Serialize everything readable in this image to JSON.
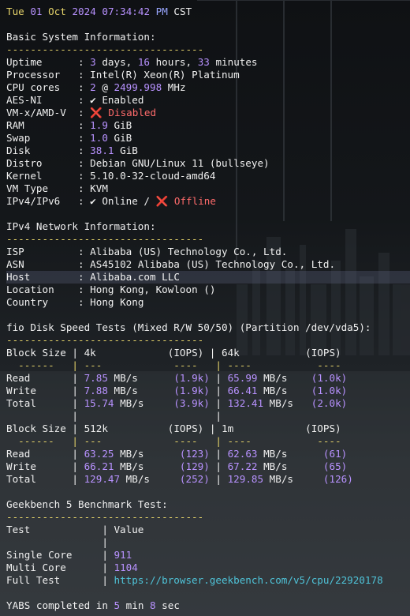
{
  "timestamp": {
    "day": "Tue",
    "date": "01",
    "month": "Oct",
    "year": "2024",
    "time": "07:34:42",
    "ampm": "PM",
    "tz": "CST"
  },
  "basic": {
    "title": "Basic System Information:",
    "dashes": "---------------------------------",
    "uptime": {
      "label": "Uptime",
      "days": "3",
      "hours": "16",
      "minutes": "33"
    },
    "processor": {
      "label": "Processor",
      "value": "Intel(R) Xeon(R) Platinum"
    },
    "cpu": {
      "label": "CPU cores",
      "count": "2",
      "freq": "2499.998",
      "unit": "MHz"
    },
    "aes": {
      "label": "AES-NI",
      "value": "✔ Enabled"
    },
    "vm": {
      "label": "VM-x/AMD-V",
      "value": "❌ Disabled"
    },
    "ram": {
      "label": "RAM",
      "value": "1.9",
      "unit": "GiB"
    },
    "swap": {
      "label": "Swap",
      "value": "1.0",
      "unit": "GiB"
    },
    "disk": {
      "label": "Disk",
      "value": "38.1",
      "unit": "GiB"
    },
    "distro": {
      "label": "Distro",
      "value": "Debian GNU/Linux 11 (bullseye)"
    },
    "kernel": {
      "label": "Kernel",
      "value": "5.10.0-32-cloud-amd64"
    },
    "vmtype": {
      "label": "VM Type",
      "value": "KVM"
    },
    "ipv": {
      "label": "IPv4/IPv6",
      "v4": "✔ Online",
      "v6": "❌ Offline"
    }
  },
  "network": {
    "title": "IPv4 Network Information:",
    "dashes": "---------------------------------",
    "isp": {
      "label": "ISP",
      "value": "Alibaba (US) Technology Co., Ltd."
    },
    "asn": {
      "label": "ASN",
      "value": "AS45102 Alibaba (US) Technology Co., Ltd."
    },
    "host": {
      "label": "Host",
      "value": "Alibaba.com LLC"
    },
    "location": {
      "label": "Location",
      "value": "Hong Kong, Kowloon ()"
    },
    "country": {
      "label": "Country",
      "value": "Hong Kong"
    }
  },
  "fio": {
    "title": "fio Disk Speed Tests (Mixed R/W 50/50) (Partition /dev/vda5):",
    "dashes": "---------------------------------",
    "blocks": [
      {
        "a": "4k",
        "b": "64k",
        "rows": [
          {
            "label": "Read",
            "a_val": "7.85",
            "a_iops": "(1.9k)",
            "b_val": "65.99",
            "b_iops": "(1.0k)"
          },
          {
            "label": "Write",
            "a_val": "7.88",
            "a_iops": "(1.9k)",
            "b_val": "66.41",
            "b_iops": "(1.0k)"
          },
          {
            "label": "Total",
            "a_val": "15.74",
            "a_iops": "(3.9k)",
            "b_val": "132.41",
            "b_iops": "(2.0k)"
          }
        ]
      },
      {
        "a": "512k",
        "b": "1m",
        "rows": [
          {
            "label": "Read",
            "a_val": "63.25",
            "a_iops": "(123)",
            "b_val": "62.63",
            "b_iops": "(61)"
          },
          {
            "label": "Write",
            "a_val": "66.21",
            "a_iops": "(129)",
            "b_val": "67.22",
            "b_iops": "(65)"
          },
          {
            "label": "Total",
            "a_val": "129.47",
            "a_iops": "(252)",
            "b_val": "129.85",
            "b_iops": "(126)"
          }
        ]
      }
    ]
  },
  "geekbench": {
    "title": "Geekbench 5 Benchmark Test:",
    "dashes": "---------------------------------",
    "single": "911",
    "multi": "1104",
    "url": "https://browser.geekbench.com/v5/cpu/22920178"
  },
  "footer": {
    "min": "5",
    "sec": "8"
  }
}
